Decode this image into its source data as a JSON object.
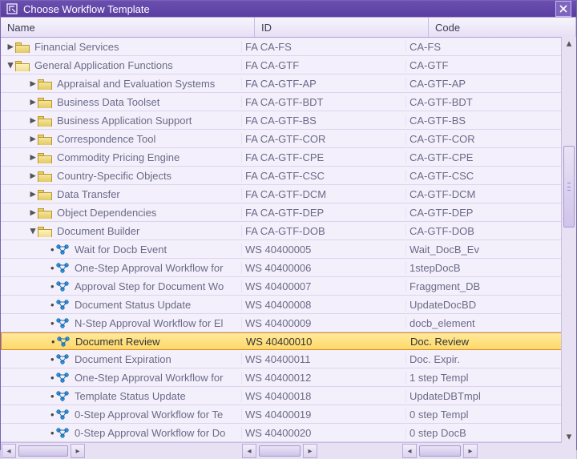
{
  "window": {
    "title": "Choose Workflow Template"
  },
  "columns": {
    "name": "Name",
    "id": "ID",
    "code": "Code"
  },
  "rows": [
    {
      "level": 0,
      "type": "folder",
      "open": false,
      "exp": "▸",
      "name": "Financial Services",
      "id": "FA CA-FS",
      "code": "CA-FS"
    },
    {
      "level": 0,
      "type": "folder",
      "open": true,
      "exp": "▾",
      "name": "General Application Functions",
      "id": "FA CA-GTF",
      "code": "CA-GTF"
    },
    {
      "level": 1,
      "type": "folder",
      "open": false,
      "exp": "▸",
      "name": "Appraisal and Evaluation Systems",
      "id": "FA CA-GTF-AP",
      "code": "CA-GTF-AP"
    },
    {
      "level": 1,
      "type": "folder",
      "open": false,
      "exp": "▸",
      "name": "Business Data Toolset",
      "id": "FA CA-GTF-BDT",
      "code": "CA-GTF-BDT"
    },
    {
      "level": 1,
      "type": "folder",
      "open": false,
      "exp": "▸",
      "name": "Business Application Support",
      "id": "FA CA-GTF-BS",
      "code": "CA-GTF-BS"
    },
    {
      "level": 1,
      "type": "folder",
      "open": false,
      "exp": "▸",
      "name": "Correspondence Tool",
      "id": "FA CA-GTF-COR",
      "code": "CA-GTF-COR"
    },
    {
      "level": 1,
      "type": "folder",
      "open": false,
      "exp": "▸",
      "name": "Commodity Pricing Engine",
      "id": "FA CA-GTF-CPE",
      "code": "CA-GTF-CPE"
    },
    {
      "level": 1,
      "type": "folder",
      "open": false,
      "exp": "▸",
      "name": "Country-Specific Objects",
      "id": "FA CA-GTF-CSC",
      "code": "CA-GTF-CSC"
    },
    {
      "level": 1,
      "type": "folder",
      "open": false,
      "exp": "▸",
      "name": "Data Transfer",
      "id": "FA CA-GTF-DCM",
      "code": "CA-GTF-DCM"
    },
    {
      "level": 1,
      "type": "folder",
      "open": false,
      "exp": "▸",
      "name": "Object Dependencies",
      "id": "FA CA-GTF-DEP",
      "code": "CA-GTF-DEP"
    },
    {
      "level": 1,
      "type": "folder",
      "open": true,
      "exp": "▾",
      "name": "Document Builder",
      "id": "FA CA-GTF-DOB",
      "code": "CA-GTF-DOB"
    },
    {
      "level": 2,
      "type": "wf",
      "name": "Wait for Docb Event",
      "id": "WS 40400005",
      "code": "Wait_DocB_Ev"
    },
    {
      "level": 2,
      "type": "wf",
      "name": "One-Step Approval Workflow for",
      "id": "WS 40400006",
      "code": "1stepDocB"
    },
    {
      "level": 2,
      "type": "wf",
      "name": "Approval Step for Document Wo",
      "id": "WS 40400007",
      "code": "Fraggment_DB"
    },
    {
      "level": 2,
      "type": "wf",
      "name": "Document Status Update",
      "id": "WS 40400008",
      "code": "UpdateDocBD"
    },
    {
      "level": 2,
      "type": "wf",
      "name": "N-Step Approval Workflow for El",
      "id": "WS 40400009",
      "code": "docb_element"
    },
    {
      "level": 2,
      "type": "wf",
      "name": "Document Review",
      "id": "WS 40400010",
      "code": "Doc. Review",
      "selected": true
    },
    {
      "level": 2,
      "type": "wf",
      "name": "Document Expiration",
      "id": "WS 40400011",
      "code": "Doc. Expir."
    },
    {
      "level": 2,
      "type": "wf",
      "name": "One-Step Approval Workflow for",
      "id": "WS 40400012",
      "code": "1 step Templ"
    },
    {
      "level": 2,
      "type": "wf",
      "name": "Template Status Update",
      "id": "WS 40400018",
      "code": "UpdateDBTmpl"
    },
    {
      "level": 2,
      "type": "wf",
      "name": "0-Step Approval Workflow for Te",
      "id": "WS 40400019",
      "code": "0 step Templ"
    },
    {
      "level": 2,
      "type": "wf",
      "name": "0-Step Approval Workflow for Do",
      "id": "WS 40400020",
      "code": "0 step DocB"
    }
  ]
}
